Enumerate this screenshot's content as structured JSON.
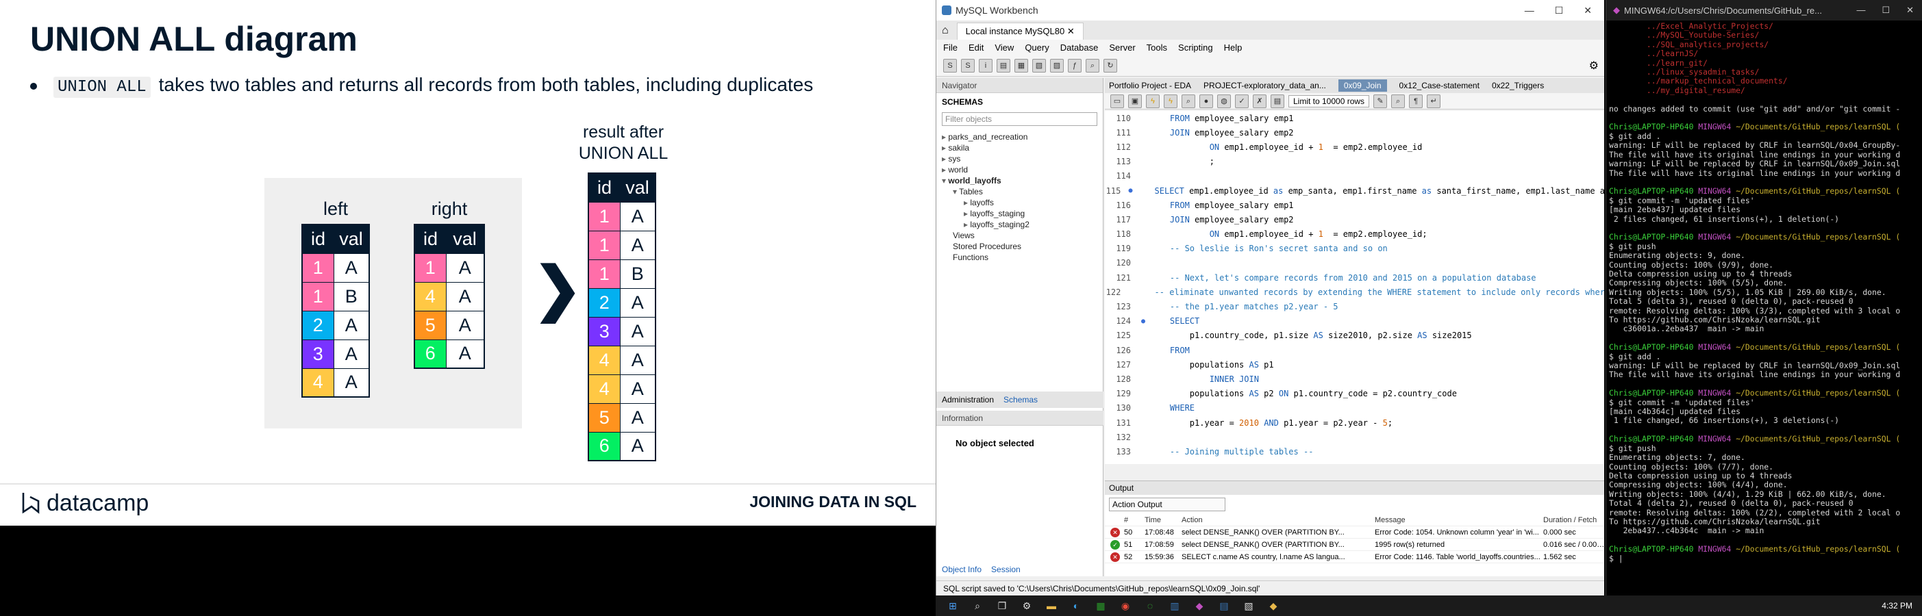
{
  "slide": {
    "title": "UNION ALL diagram",
    "bullet_code": "UNION ALL",
    "bullet_text": "takes two tables and returns all records from both tables, including duplicates",
    "left_title": "left",
    "right_title": "right",
    "result_title_1": "result after",
    "result_title_2": "UNION ALL",
    "col_id": "id",
    "col_val": "val",
    "left_rows": [
      {
        "id": "1",
        "val": "A",
        "color": "#ff6ea9"
      },
      {
        "id": "1",
        "val": "B",
        "color": "#ff6ea9"
      },
      {
        "id": "2",
        "val": "A",
        "color": "#03b0f0"
      },
      {
        "id": "3",
        "val": "A",
        "color": "#7933ff"
      },
      {
        "id": "4",
        "val": "A",
        "color": "#ffc844"
      }
    ],
    "right_rows": [
      {
        "id": "1",
        "val": "A",
        "color": "#ff6ea9"
      },
      {
        "id": "4",
        "val": "A",
        "color": "#ffc844"
      },
      {
        "id": "5",
        "val": "A",
        "color": "#ff931e"
      },
      {
        "id": "6",
        "val": "A",
        "color": "#03ef62"
      }
    ],
    "result_rows": [
      {
        "id": "1",
        "val": "A",
        "color": "#ff6ea9"
      },
      {
        "id": "1",
        "val": "A",
        "color": "#ff6ea9"
      },
      {
        "id": "1",
        "val": "B",
        "color": "#ff6ea9"
      },
      {
        "id": "2",
        "val": "A",
        "color": "#03b0f0"
      },
      {
        "id": "3",
        "val": "A",
        "color": "#7933ff"
      },
      {
        "id": "4",
        "val": "A",
        "color": "#ffc844"
      },
      {
        "id": "4",
        "val": "A",
        "color": "#ffc844"
      },
      {
        "id": "5",
        "val": "A",
        "color": "#ff931e"
      },
      {
        "id": "6",
        "val": "A",
        "color": "#03ef62"
      }
    ],
    "chevron": "❯",
    "logo_text": "datacamp",
    "footer_title": "JOINING DATA IN SQL"
  },
  "workbench": {
    "window_title": "MySQL Workbench",
    "connection_tab": "Local instance MySQL80",
    "menu": [
      "File",
      "Edit",
      "View",
      "Query",
      "Database",
      "Server",
      "Tools",
      "Scripting",
      "Help"
    ],
    "navigator_title": "Navigator",
    "schemas_label": "SCHEMAS",
    "filter_placeholder": "Filter objects",
    "schemas": [
      "parks_and_recreation",
      "sakila",
      "sys",
      "world"
    ],
    "open_schema": "world_layoffs",
    "tables_label": "Tables",
    "tables": [
      "layoffs",
      "layoffs_staging",
      "layoffs_staging2"
    ],
    "other_nodes": [
      "Views",
      "Stored Procedures",
      "Functions"
    ],
    "nav_tab_admin": "Administration",
    "nav_tab_schemas": "Schemas",
    "information_label": "Information",
    "no_object": "No object selected",
    "bottom_tab_1": "Object Info",
    "bottom_tab_2": "Session",
    "editor_tabs": [
      "Portfolio Project - EDA",
      "PROJECT-exploratory_data_an...",
      "0x09_Join",
      "0x12_Case-statement",
      "0x22_Triggers"
    ],
    "active_tab_index": 2,
    "limit_label": "Limit to 10000 rows",
    "code_lines": [
      {
        "n": "110",
        "t": "    FROM employee_salary emp1"
      },
      {
        "n": "111",
        "t": "    JOIN employee_salary emp2"
      },
      {
        "n": "112",
        "t": "            ON emp1.employee_id + 1  = emp2.employee_id"
      },
      {
        "n": "113",
        "t": "            ;"
      },
      {
        "n": "114",
        "t": ""
      },
      {
        "n": "115",
        "t": "    SELECT emp1.employee_id as emp_santa, emp1.first_name as santa_first_name, emp1.last_name a"
      },
      {
        "n": "116",
        "t": "    FROM employee_salary emp1"
      },
      {
        "n": "117",
        "t": "    JOIN employee_salary emp2"
      },
      {
        "n": "118",
        "t": "            ON emp1.employee_id + 1  = emp2.employee_id;"
      },
      {
        "n": "119",
        "t": "    -- So leslie is Ron's secret santa and so on"
      },
      {
        "n": "120",
        "t": ""
      },
      {
        "n": "121",
        "t": "    -- Next, let's compare records from 2010 and 2015 on a population database"
      },
      {
        "n": "122",
        "t": "    -- eliminate unwanted records by extending the WHERE statement to include only records wher"
      },
      {
        "n": "123",
        "t": "    -- the p1.year matches p2.year - 5"
      },
      {
        "n": "124",
        "t": "    SELECT"
      },
      {
        "n": "125",
        "t": "        p1.country_code, p1.size AS size2010, p2.size AS size2015"
      },
      {
        "n": "126",
        "t": "    FROM"
      },
      {
        "n": "127",
        "t": "        populations AS p1"
      },
      {
        "n": "128",
        "t": "            INNER JOIN"
      },
      {
        "n": "129",
        "t": "        populations AS p2 ON p1.country_code = p2.country_code"
      },
      {
        "n": "130",
        "t": "    WHERE"
      },
      {
        "n": "131",
        "t": "        p1.year = 2010 AND p1.year = p2.year - 5;"
      },
      {
        "n": "132",
        "t": ""
      },
      {
        "n": "133",
        "t": "    -- Joining multiple tables --"
      }
    ],
    "output_label": "Output",
    "action_output": "Action Output",
    "out_headers": [
      "#",
      "Time",
      "Action",
      "Message",
      "Duration / Fetch"
    ],
    "out_rows": [
      {
        "status": "err",
        "num": "50",
        "time": "17:08:48",
        "action": "select DENSE_RANK() OVER (PARTITION BY...",
        "message": "Error Code: 1054. Unknown column 'year' in 'wi...",
        "duration": "0.000 sec"
      },
      {
        "status": "ok",
        "num": "51",
        "time": "17:08:59",
        "action": "select DENSE_RANK() OVER (PARTITION BY...",
        "message": "1995 row(s) returned",
        "duration": "0.016 sec / 0.000 sec"
      },
      {
        "status": "err",
        "num": "52",
        "time": "15:59:36",
        "action": "SELECT c.name AS country, l.name AS langua...",
        "message": "Error Code: 1146. Table 'world_layoffs.countries...",
        "duration": "1.562 sec"
      }
    ],
    "status_text": "SQL script saved to 'C:\\Users\\Chris\\Documents\\GitHub_repos\\learnSQL\\0x09_Join.sql'"
  },
  "terminal": {
    "title": "MINGW64:/c/Users/Chris/Documents/GitHub_re...",
    "lines": [
      {
        "c": "t-red",
        "t": "        ../Excel_Analytic_Projects/"
      },
      {
        "c": "t-red",
        "t": "        ../MySQL_Youtube-Series/"
      },
      {
        "c": "t-red",
        "t": "        ../SQL_analytics_projects/"
      },
      {
        "c": "t-red",
        "t": "        ../learnJS/"
      },
      {
        "c": "t-red",
        "t": "        ../learn_git/"
      },
      {
        "c": "t-red",
        "t": "        ../linux_sysadmin_tasks/"
      },
      {
        "c": "t-red",
        "t": "        ../markup_technical_documents/"
      },
      {
        "c": "t-red",
        "t": "        ../my_digital_resume/"
      },
      {
        "c": "",
        "t": ""
      },
      {
        "c": "",
        "t": "no changes added to commit (use \"git add\" and/or \"git commit -"
      },
      {
        "c": "",
        "t": ""
      },
      {
        "c": "t-green",
        "t": "Chris@LAPTOP-HP640 MINGW64 ~/Documents/GitHub_repos/learnSQL ("
      },
      {
        "c": "",
        "t": "$ git add ."
      },
      {
        "c": "",
        "t": "warning: LF will be replaced by CRLF in learnSQL/0x04_GroupBy-"
      },
      {
        "c": "",
        "t": "The file will have its original line endings in your working d"
      },
      {
        "c": "",
        "t": "warning: LF will be replaced by CRLF in learnSQL/0x09_Join.sql"
      },
      {
        "c": "",
        "t": "The file will have its original line endings in your working d"
      },
      {
        "c": "",
        "t": ""
      },
      {
        "c": "t-green",
        "t": "Chris@LAPTOP-HP640 MINGW64 ~/Documents/GitHub_repos/learnSQL ("
      },
      {
        "c": "",
        "t": "$ git commit -m 'updated files'"
      },
      {
        "c": "",
        "t": "[main 2eba437] updated files"
      },
      {
        "c": "",
        "t": " 2 files changed, 61 insertions(+), 1 deletion(-)"
      },
      {
        "c": "",
        "t": ""
      },
      {
        "c": "t-green",
        "t": "Chris@LAPTOP-HP640 MINGW64 ~/Documents/GitHub_repos/learnSQL ("
      },
      {
        "c": "",
        "t": "$ git push"
      },
      {
        "c": "",
        "t": "Enumerating objects: 9, done."
      },
      {
        "c": "",
        "t": "Counting objects: 100% (9/9), done."
      },
      {
        "c": "",
        "t": "Delta compression using up to 4 threads"
      },
      {
        "c": "",
        "t": "Compressing objects: 100% (5/5), done."
      },
      {
        "c": "",
        "t": "Writing objects: 100% (5/5), 1.05 KiB | 269.00 KiB/s, done."
      },
      {
        "c": "",
        "t": "Total 5 (delta 3), reused 0 (delta 0), pack-reused 0"
      },
      {
        "c": "",
        "t": "remote: Resolving deltas: 100% (3/3), completed with 3 local o"
      },
      {
        "c": "",
        "t": "To https://github.com/ChrisNzoka/learnSQL.git"
      },
      {
        "c": "",
        "t": "   c36001a..2eba437  main -> main"
      },
      {
        "c": "",
        "t": ""
      },
      {
        "c": "t-green",
        "t": "Chris@LAPTOP-HP640 MINGW64 ~/Documents/GitHub_repos/learnSQL ("
      },
      {
        "c": "",
        "t": "$ git add ."
      },
      {
        "c": "",
        "t": "warning: LF will be replaced by CRLF in learnSQL/0x09_Join.sql"
      },
      {
        "c": "",
        "t": "The file will have its original line endings in your working d"
      },
      {
        "c": "",
        "t": ""
      },
      {
        "c": "t-green",
        "t": "Chris@LAPTOP-HP640 MINGW64 ~/Documents/GitHub_repos/learnSQL ("
      },
      {
        "c": "",
        "t": "$ git commit -m 'updated files'"
      },
      {
        "c": "",
        "t": "[main c4b364c] updated files"
      },
      {
        "c": "",
        "t": " 1 file changed, 66 insertions(+), 3 deletions(-)"
      },
      {
        "c": "",
        "t": ""
      },
      {
        "c": "t-green",
        "t": "Chris@LAPTOP-HP640 MINGW64 ~/Documents/GitHub_repos/learnSQL ("
      },
      {
        "c": "",
        "t": "$ git push"
      },
      {
        "c": "",
        "t": "Enumerating objects: 7, done."
      },
      {
        "c": "",
        "t": "Counting objects: 100% (7/7), done."
      },
      {
        "c": "",
        "t": "Delta compression using up to 4 threads"
      },
      {
        "c": "",
        "t": "Compressing objects: 100% (4/4), done."
      },
      {
        "c": "",
        "t": "Writing objects: 100% (4/4), 1.29 KiB | 662.00 KiB/s, done."
      },
      {
        "c": "",
        "t": "Total 4 (delta 2), reused 0 (delta 0), pack-reused 0"
      },
      {
        "c": "",
        "t": "remote: Resolving deltas: 100% (2/2), completed with 2 local o"
      },
      {
        "c": "",
        "t": "To https://github.com/ChrisNzoka/learnSQL.git"
      },
      {
        "c": "",
        "t": "   2eba437..c4b364c  main -> main"
      },
      {
        "c": "",
        "t": ""
      },
      {
        "c": "t-green",
        "t": "Chris@LAPTOP-HP640 MINGW64 ~/Documents/GitHub_repos/learnSQL ("
      },
      {
        "c": "",
        "t": "$ |"
      }
    ]
  },
  "taskbar": {
    "clock": "4:32 PM"
  }
}
